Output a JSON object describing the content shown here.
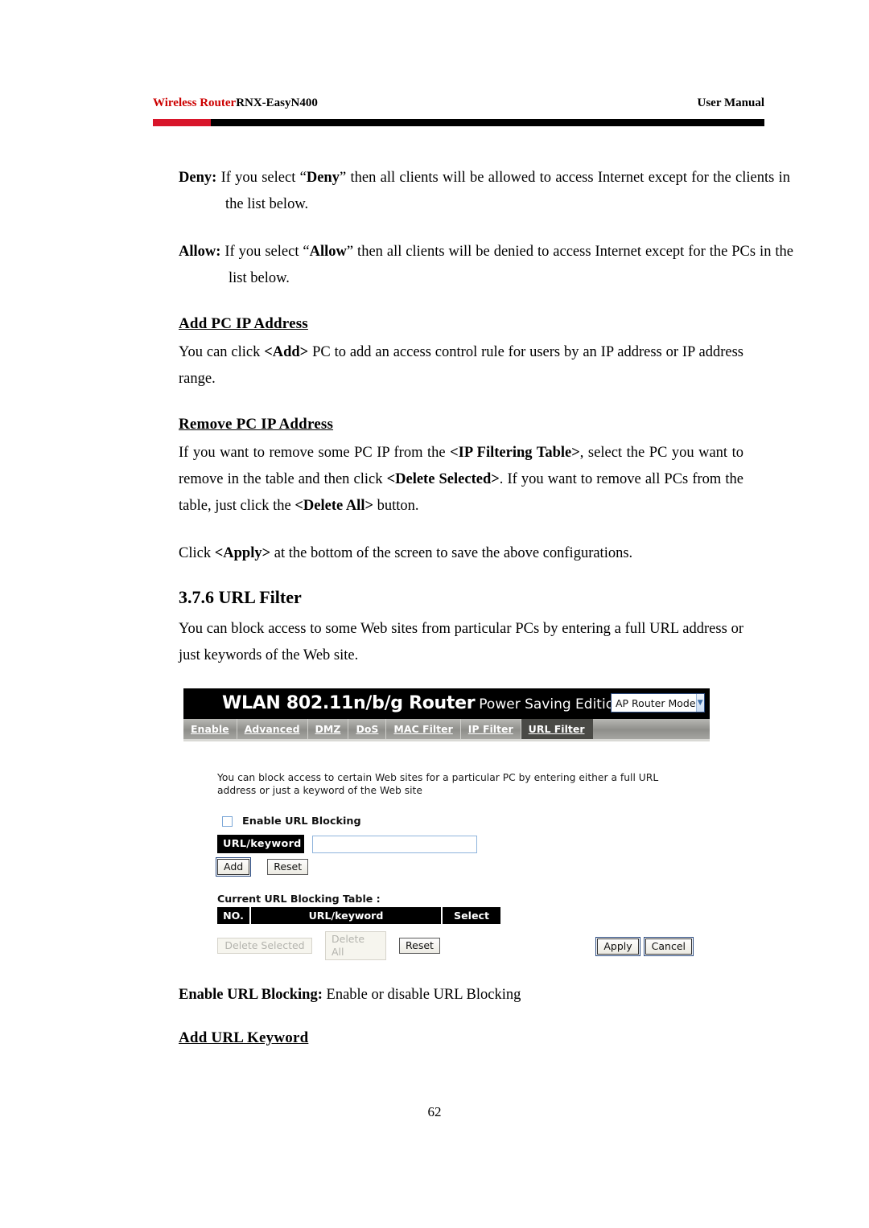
{
  "doc_header": {
    "brand": "Wireless Router",
    "model": "RNX-EasyN400",
    "right": "User Manual",
    "rule_red": "#d8152a",
    "rule_black": "#000000"
  },
  "body": {
    "deny_label": "Deny:",
    "deny_text_1": " If you select “",
    "deny_word": "Deny",
    "deny_text_2": "” then all clients will be allowed to access Internet except for the clients in the list below.",
    "allow_label": "Allow:",
    "allow_text_1": " If you select “",
    "allow_word": "Allow",
    "allow_text_2": "” then all clients will be denied to access Internet except for the PCs in the list below.",
    "add_pc_heading": "Add PC IP Address",
    "add_pc_p1": "You can click ",
    "add_pc_bold": "<Add>",
    "add_pc_p2": " PC to add an access control rule for users by an IP address or IP address range.",
    "remove_pc_heading": "Remove PC IP Address",
    "remove_p1": "If you want to remove some PC IP from the ",
    "remove_b1": "<IP Filtering Table>",
    "remove_p2": ", select the PC you want to remove in the table and then click ",
    "remove_b2": "<Delete Selected>",
    "remove_p3": ". If you want to remove all PCs from the table, just click the ",
    "remove_b3": "<Delete All>",
    "remove_p4": " button.",
    "apply_p1": "Click ",
    "apply_b1": "<Apply>",
    "apply_p2": " at the bottom of the screen to save the above configurations.",
    "section_number_title": "3.7.6 URL Filter",
    "url_filter_p": "You can block access to some Web sites from particular PCs by entering a full URL address or just keywords of the Web site.",
    "enable_url_label": "Enable URL Blocking:",
    "enable_url_text": " Enable or disable URL Blocking",
    "add_url_keyword_heading": "Add URL Keyword",
    "page_number": "62"
  },
  "router_ui": {
    "title_main": "WLAN 802.11n/b/g Router",
    "title_sub": "Power Saving Edition",
    "mode_select": {
      "value": "AP Router Mode",
      "arrow_icon": "chevron-down-icon"
    },
    "tabs": [
      {
        "label": "Enable",
        "active": false
      },
      {
        "label": "Advanced",
        "active": false
      },
      {
        "label": "DMZ",
        "active": false
      },
      {
        "label": "DoS",
        "active": false
      },
      {
        "label": "MAC Filter",
        "active": false
      },
      {
        "label": "IP Filter",
        "active": false
      },
      {
        "label": "URL Filter",
        "active": true
      }
    ],
    "intro_text": "You can block access to certain Web sites for a particular PC by entering either a full URL address or just a keyword of the Web site",
    "enable_checkbox": {
      "label": "Enable URL Blocking",
      "checked": false
    },
    "keyword_field": {
      "label": "URL/keyword",
      "value": ""
    },
    "buttons_row1": [
      {
        "label": "Add",
        "disabled": false,
        "focused": true
      },
      {
        "label": "Reset",
        "disabled": false,
        "focused": false
      }
    ],
    "table_caption": "Current URL Blocking Table :",
    "table_headers": [
      "NO.",
      "URL/keyword",
      "Select"
    ],
    "table_rows": [],
    "buttons_row2": [
      {
        "label": "Delete Selected",
        "disabled": true,
        "focused": false
      },
      {
        "label": "Delete All",
        "disabled": true,
        "focused": false
      },
      {
        "label": "Reset",
        "disabled": false,
        "focused": false
      }
    ],
    "buttons_row3": [
      {
        "label": "Apply",
        "disabled": false,
        "focused": true
      },
      {
        "label": "Cancel",
        "disabled": false,
        "focused": true
      }
    ]
  }
}
